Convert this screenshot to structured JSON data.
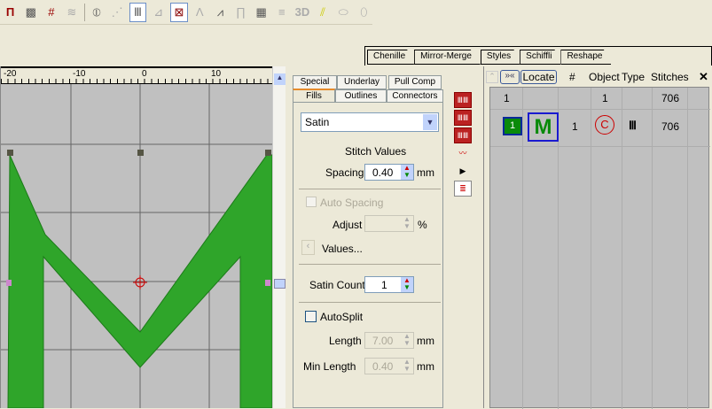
{
  "toolbar": {
    "icons": [
      "satin-fill-icon",
      "tatami-fill-icon",
      "cross-stitch-icon",
      "wave-fill-icon",
      "stitch-grid-icon",
      "fan-fill-icon",
      "satin-icon",
      "fill-angle-icon",
      "fixed-angle-icon",
      "zigzag-icon",
      "pattern-fill-icon",
      "column-icon",
      "step-fill-icon",
      "lines-icon",
      "3d-icon",
      "gradient-icon",
      "raised-icon",
      "puffy-icon"
    ],
    "label_3d": "3D"
  },
  "top_tabs": [
    "Chenille",
    "Mirror-Merge",
    "Styles",
    "Schiffli",
    "Reshape"
  ],
  "ruler": {
    "labels": [
      "-20",
      "-10",
      "0",
      "10"
    ]
  },
  "props": {
    "tabs_top": [
      "Special",
      "Underlay",
      "Pull Comp"
    ],
    "tabs_bottom": [
      "Fills",
      "Outlines",
      "Connectors"
    ],
    "fill_type": "Satin",
    "stitch_values": "Stitch Values",
    "spacing_label": "Spacing",
    "spacing_value": "0.40",
    "mm": "mm",
    "auto_spacing": "Auto Spacing",
    "adjust_label": "Adjust",
    "adjust_value": "",
    "percent": "%",
    "values_button": "Values...",
    "satin_count_label": "Satin Count",
    "satin_count_value": "1",
    "autosplit": "AutoSplit",
    "length_label": "Length",
    "length_value": "7.00",
    "min_length_label": "Min Length",
    "min_length_value": "0.40"
  },
  "objects": {
    "locate": "Locate",
    "headers": [
      "#",
      "Object",
      "Type",
      "Stitches"
    ],
    "group_row": {
      "num": "1",
      "object": "1",
      "stitches": "706"
    },
    "row": {
      "color": "1",
      "thumb": "M",
      "num": "1",
      "stitches": "706"
    },
    "accent": "#0a8a0a"
  }
}
